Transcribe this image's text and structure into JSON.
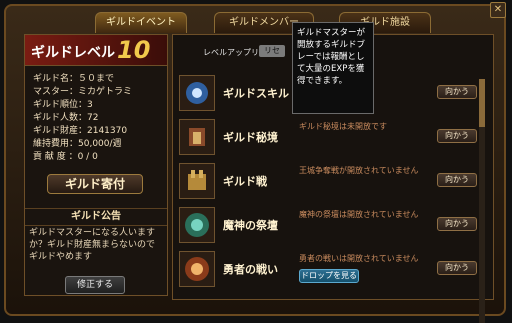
{
  "tabs": [
    {
      "label": "ギルドイベント"
    },
    {
      "label": "ギルドメンバー"
    },
    {
      "label": "ギルド施設"
    }
  ],
  "left": {
    "guild_level_label": "ギルドレベル",
    "guild_level_value": "10",
    "info_rows": [
      "ギルド名：５０まで",
      "マスター：ミカゲトラミ",
      "ギルド順位：3",
      "ギルド人数：72",
      "ギルド財産：2141370",
      "維持費用：50,000/週",
      "貢 献 度 ：0 / 0"
    ],
    "donate_label": "ギルド寄付",
    "notice_title": "ギルド公告",
    "notice_text": "ギルドマスターになる人います か？ギルド財産無まらないのでギルドやめます",
    "edit_label": "修正する"
  },
  "right": {
    "level_up_label": "レベルアップリセット",
    "reset_label": "リセ",
    "items": [
      {
        "name": "ギルドスキル",
        "desc": "",
        "go": "向かう",
        "drop": ""
      },
      {
        "name": "ギルド秘境",
        "desc": "ギルド秘境は未開放です",
        "go": "向かう",
        "drop": ""
      },
      {
        "name": "ギルド戦",
        "desc": "王城争奪戦が開放されていません",
        "go": "向かう",
        "drop": ""
      },
      {
        "name": "魔神の祭壇",
        "desc": "魔神の祭壇は開放されていません",
        "go": "向かう",
        "drop": ""
      },
      {
        "name": "勇者の戦い",
        "desc": "勇者の戦いは開放されていません",
        "go": "向かう",
        "drop": "ドロップを見る"
      }
    ],
    "tooltip": "ギルドマスターが開放するギルドブレーでは報酬として大量のEXPを獲得できます。"
  }
}
